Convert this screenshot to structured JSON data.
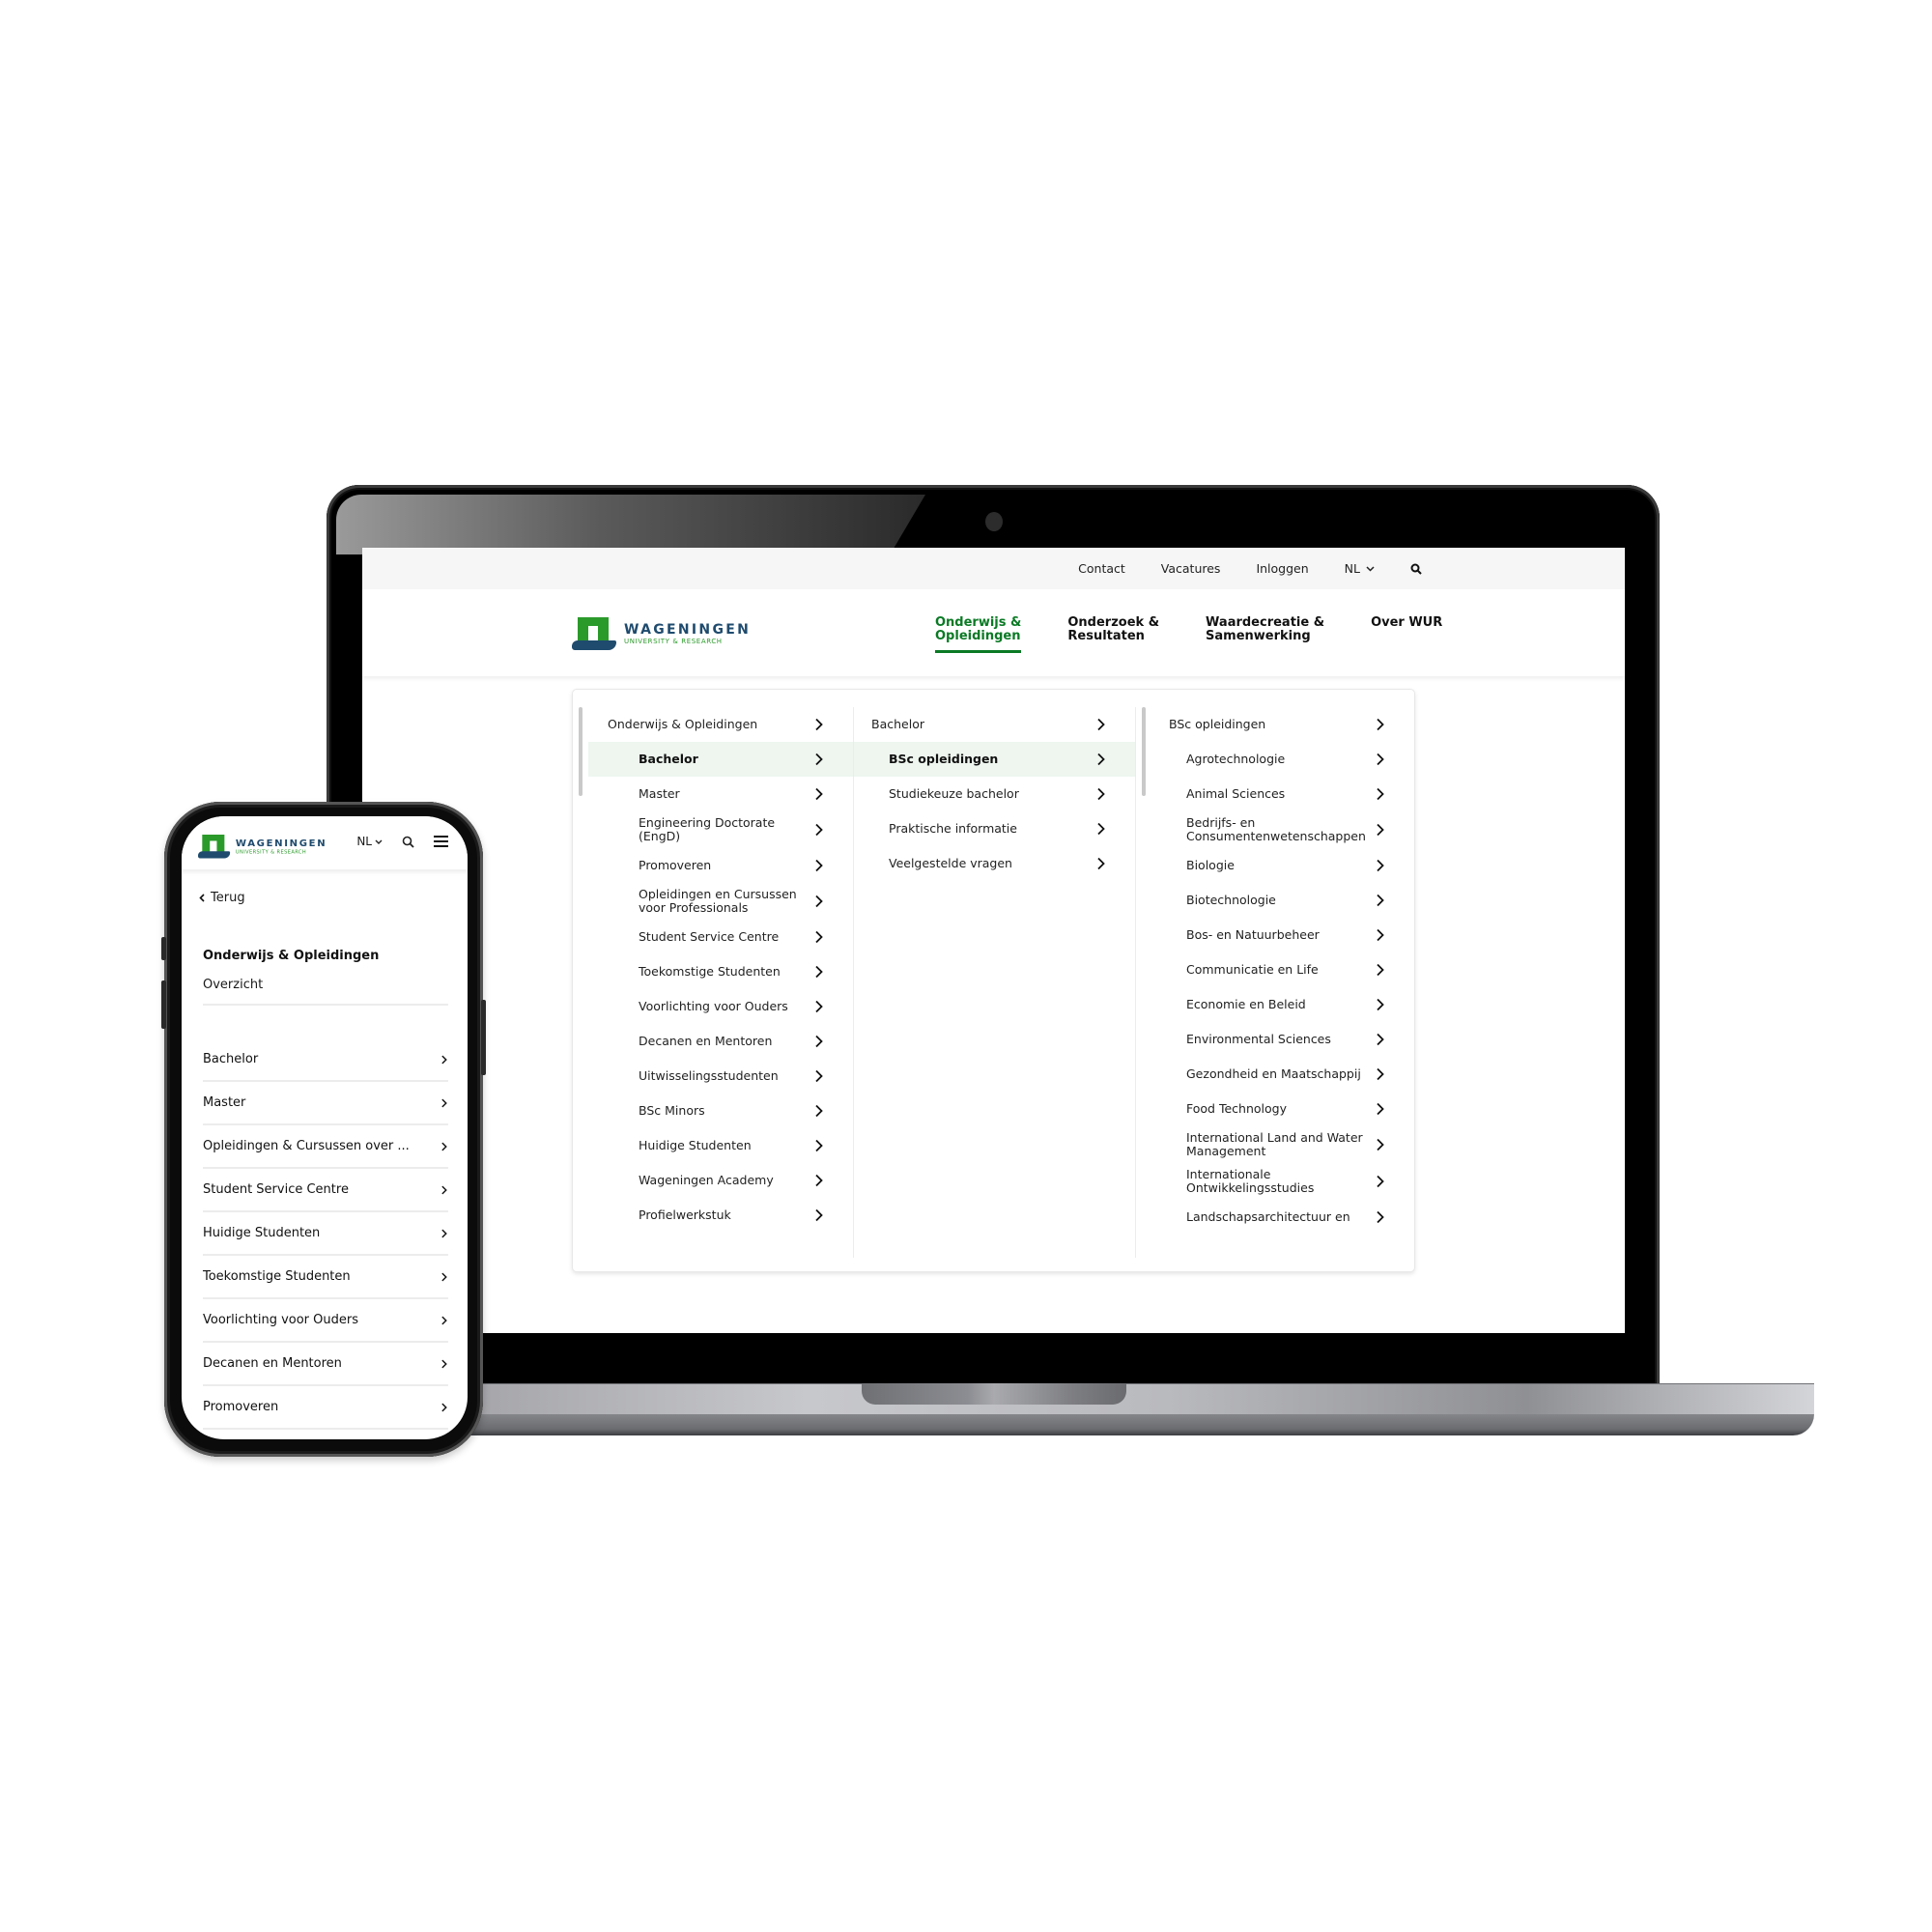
{
  "desktop": {
    "utility_links": [
      "Contact",
      "Vacatures",
      "Inloggen"
    ],
    "language": "NL",
    "logo": {
      "line1": "WAGENINGEN",
      "line2": "UNIVERSITY & RESEARCH"
    },
    "main_nav": [
      {
        "label": "Onderwijs &\nOpleidingen",
        "active": true
      },
      {
        "label": "Onderzoek &\nResultaten",
        "active": false
      },
      {
        "label": "Waardecreatie &\nSamenwerking",
        "active": false
      },
      {
        "label": "Over WUR",
        "active": false
      }
    ],
    "mega_menu": {
      "column1": {
        "heading": "Onderwijs & Opleidingen",
        "items": [
          {
            "label": "Bachelor",
            "selected": true
          },
          {
            "label": "Master"
          },
          {
            "label": "Engineering Doctorate (EngD)"
          },
          {
            "label": "Promoveren"
          },
          {
            "label": "Opleidingen en Cursussen voor Professionals"
          },
          {
            "label": "Student Service Centre"
          },
          {
            "label": "Toekomstige Studenten"
          },
          {
            "label": "Voorlichting voor Ouders"
          },
          {
            "label": "Decanen en Mentoren"
          },
          {
            "label": "Uitwisselingsstudenten"
          },
          {
            "label": "BSc Minors"
          },
          {
            "label": "Huidige Studenten"
          },
          {
            "label": "Wageningen Academy"
          },
          {
            "label": "Profielwerkstuk"
          }
        ]
      },
      "column2": {
        "heading": "Bachelor",
        "items": [
          {
            "label": "BSc opleidingen",
            "selected": true
          },
          {
            "label": "Studiekeuze bachelor"
          },
          {
            "label": "Praktische informatie"
          },
          {
            "label": "Veelgestelde vragen"
          }
        ]
      },
      "column3": {
        "heading": "BSc opleidingen",
        "items": [
          {
            "label": "Agrotechnologie"
          },
          {
            "label": "Animal Sciences"
          },
          {
            "label": "Bedrijfs- en Consumentenwetenschappen"
          },
          {
            "label": "Biologie"
          },
          {
            "label": "Biotechnologie"
          },
          {
            "label": "Bos- en Natuurbeheer"
          },
          {
            "label": "Communicatie en Life"
          },
          {
            "label": "Economie en Beleid"
          },
          {
            "label": "Environmental Sciences"
          },
          {
            "label": "Gezondheid en Maatschappij"
          },
          {
            "label": "Food Technology"
          },
          {
            "label": "International Land and Water Management"
          },
          {
            "label": "Internationale Ontwikkelingsstudies"
          },
          {
            "label": "Landschapsarchitectuur en"
          }
        ]
      }
    }
  },
  "mobile": {
    "logo": {
      "line1": "WAGENINGEN",
      "line2": "UNIVERSITY & RESEARCH"
    },
    "language": "NL",
    "back_label": "Terug",
    "section_title": "Onderwijs & Opleidingen",
    "overview_label": "Overzicht",
    "items": [
      "Bachelor",
      "Master",
      "Opleidingen & Cursussen over ...",
      "Student Service Centre",
      "Huidige Studenten",
      "Toekomstige Studenten",
      "Voorlichting voor Ouders",
      "Decanen en Mentoren",
      "Promoveren"
    ]
  },
  "colors": {
    "brand_green": "#0b7a25",
    "logo_green": "#2a9a2a",
    "logo_blue": "#1f4b6e",
    "selected_row_bg": "#eef6ef"
  }
}
